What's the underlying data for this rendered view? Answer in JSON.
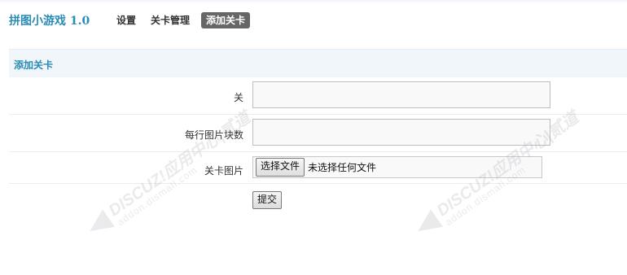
{
  "app": {
    "title": "拼图小游戏 1.0"
  },
  "nav": {
    "items": [
      {
        "label": "设置"
      },
      {
        "label": "关卡管理"
      },
      {
        "label": "添加关卡",
        "active": true
      }
    ]
  },
  "section": {
    "title": "添加关卡"
  },
  "form": {
    "level_label": "关",
    "level_value": "",
    "pieces_label": "每行图片块数",
    "pieces_value": "",
    "image_label": "关卡图片",
    "file_button_label": "选择文件",
    "file_status": "未选择任何文件",
    "submit_label": "提交"
  },
  "watermark": {
    "brand": "DISCUZ!应用中心|贰道",
    "url": "addon.dismall.com"
  },
  "colors": {
    "accent": "#2a8bb4",
    "active_tab_bg": "#666666",
    "section_bg": "#f1f6fb"
  }
}
